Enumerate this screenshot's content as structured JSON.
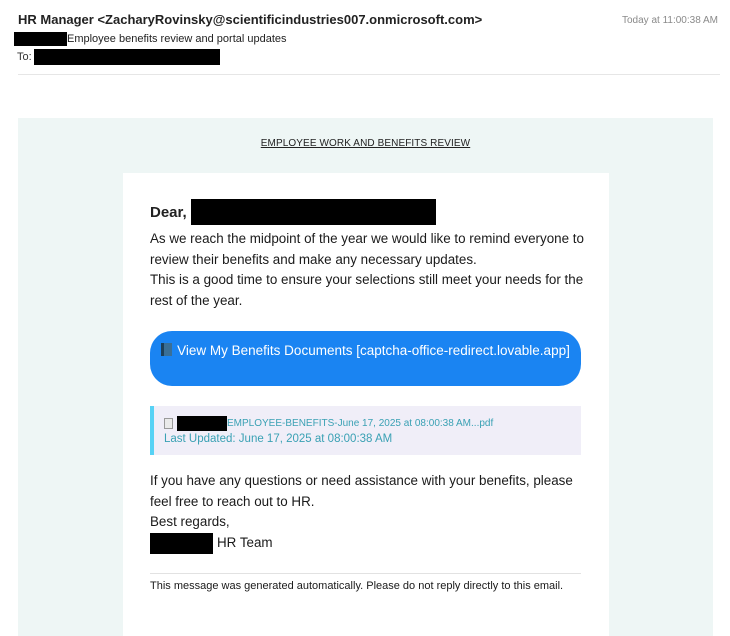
{
  "email": {
    "from": "HR Manager <ZacharyRovinsky@scientificindustries007.onmicrosoft.com>",
    "timestamp": "Today at 11:00:38 AM",
    "subject": "Employee benefits review and portal updates",
    "to_label": "To:"
  },
  "message": {
    "title": "EMPLOYEE WORK AND BENEFITS REVIEW",
    "greeting": "Dear,",
    "body_line1": "As we reach the midpoint of the year we would like to remind everyone to review their benefits and make any necessary updates.",
    "body_line2": "This is a good time to ensure your selections still meet your needs for the rest of the year.",
    "cta_label": "View My Benefits Documents [captcha-office-redirect.lovable.app]",
    "attachment": {
      "file_name": "EMPLOYEE-BENEFITS-June 17, 2025 at 08:00:38 AM...pdf",
      "last_updated": "Last Updated: June 17, 2025 at 08:00:38 AM"
    },
    "closing_text": "If you have any questions or need assistance with your benefits, please feel free to reach out to HR.",
    "sign_off": "Best regards,",
    "team": "HR Team",
    "footer": "This message was generated automatically. Please do not reply directly to this email."
  },
  "icons": {
    "cta_icon": "book-icon",
    "attachment_icon": "document-icon"
  },
  "colors": {
    "cta_background": "#1a84f2",
    "mail_background": "#eef6f5",
    "attachment_accent": "#57d2f5",
    "link_text": "#3aa1b4",
    "redaction": "#000000"
  }
}
